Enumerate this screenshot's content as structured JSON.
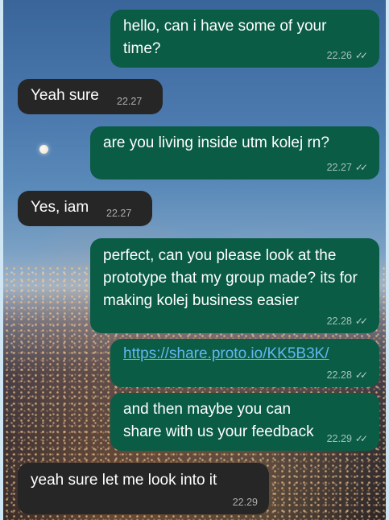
{
  "chat": {
    "messages": [
      {
        "direction": "sent",
        "text": "hello, can i have some of your time?",
        "time": "22.26",
        "status": "read"
      },
      {
        "direction": "received",
        "text": "Yeah sure",
        "time": "22.27"
      },
      {
        "direction": "sent",
        "text": "are you living inside utm kolej rn?",
        "time": "22.27",
        "status": "read"
      },
      {
        "direction": "received",
        "text": "Yes, iam",
        "time": "22.27"
      },
      {
        "direction": "sent",
        "text": "perfect, can you please look at the prototype that my group made? its for making kolej business easier",
        "time": "22.28",
        "status": "read"
      },
      {
        "direction": "sent",
        "text": "https://share.proto.io/KK5B3K/",
        "time": "22.28",
        "status": "read",
        "is_link": true
      },
      {
        "direction": "sent",
        "text": "and then maybe you can share with us your feedback",
        "time": "22.29",
        "status": "read"
      },
      {
        "direction": "received",
        "text": "yeah sure let me look into it",
        "time": "22.29"
      }
    ]
  },
  "icons": {
    "read_receipt": "double-check-icon"
  },
  "colors": {
    "sent_bubble": "#0a5c45",
    "received_bubble": "#262626",
    "link": "#62b7f0",
    "frame_border": "#cfe6f5"
  }
}
